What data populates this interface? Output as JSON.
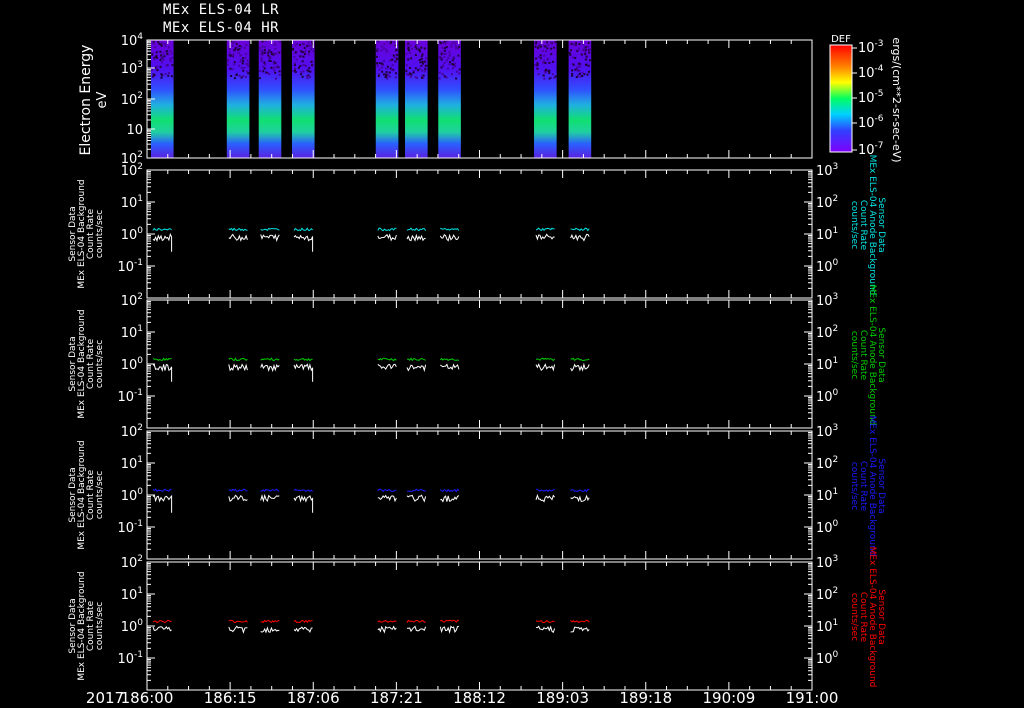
{
  "titles": [
    "MEx ELS-04 LR",
    "MEx ELS-04 HR"
  ],
  "year_label": "2017",
  "x_axis": {
    "ticks": [
      "186:00",
      "186:15",
      "187:06",
      "187:21",
      "188:12",
      "189:03",
      "189:18",
      "190:09",
      "191:00"
    ]
  },
  "colors": {
    "background": "#000000",
    "axes": "#ffffff",
    "panel1": "#00e5e5",
    "panel2": "#00cc00",
    "panel3": "#1a1aff",
    "panel4": "#ff0000",
    "trace": "#ffffff"
  },
  "spectrogram": {
    "ylabel": "Electron Energy",
    "yunit": "eV",
    "yticks": [
      "10",
      "10",
      "10",
      "10",
      "10"
    ],
    "yexps": [
      "4",
      "3",
      "2",
      "",
      "2"
    ],
    "colorbar_label": "DEF",
    "colorbar_ticks": [
      "10",
      "10",
      "10",
      "10",
      "10"
    ],
    "colorbar_exps": [
      "-3",
      "-4",
      "-5",
      "-6",
      "-7"
    ],
    "colorbar_unit": "ergs/(cm**2-sr-sec-eV)"
  },
  "panels": [
    {
      "left_label": [
        "Sensor Data",
        "MEx ELS-04 Background",
        "Count Rate",
        "counts/sec"
      ],
      "right_label": [
        "Sensor Data",
        "MEx ELS-04 Anode Background",
        "Count Rate",
        "counts/sec"
      ],
      "left_ticks": [
        "10",
        "10",
        "10",
        "10"
      ],
      "left_exps": [
        "2",
        "1",
        "0",
        "-1"
      ],
      "right_ticks": [
        "10",
        "10",
        "10",
        "10"
      ],
      "right_exps": [
        "3",
        "2",
        "1",
        "0"
      ]
    },
    {
      "left_label": [
        "Sensor Data",
        "MEx ELS-04 Background",
        "Count Rate",
        "counts/sec"
      ],
      "right_label": [
        "Sensor Data",
        "MEx ELS-04 Anode Background",
        "Count Rate",
        "counts/sec"
      ],
      "left_ticks": [
        "10",
        "10",
        "10",
        "10"
      ],
      "left_exps": [
        "2",
        "1",
        "0",
        "-1"
      ],
      "right_ticks": [
        "10",
        "10",
        "10",
        "10"
      ],
      "right_exps": [
        "3",
        "2",
        "1",
        "0"
      ]
    },
    {
      "left_label": [
        "Sensor Data",
        "MEx ELS-04 Background",
        "Count Rate",
        "counts/sec"
      ],
      "right_label": [
        "Sensor Data",
        "MEx ELS-04 Anode Background",
        "Count Rate",
        "counts/sec"
      ],
      "left_ticks": [
        "10",
        "10",
        "10",
        "10"
      ],
      "left_exps": [
        "2",
        "1",
        "0",
        "-1"
      ],
      "right_ticks": [
        "10",
        "10",
        "10",
        "10"
      ],
      "right_exps": [
        "3",
        "2",
        "1",
        "0"
      ]
    },
    {
      "left_label": [
        "Sensor Data",
        "MEx ELS-04 Background",
        "Count Rate",
        "counts/sec"
      ],
      "right_label": [
        "Sensor Data",
        "MEx ELS-04 Anode Background",
        "Count Rate",
        "counts/sec"
      ],
      "left_ticks": [
        "10",
        "10",
        "10",
        "10"
      ],
      "left_exps": [
        "2",
        "1",
        "0",
        "-1"
      ],
      "right_ticks": [
        "10",
        "10",
        "10",
        "10"
      ],
      "right_exps": [
        "3",
        "2",
        "1",
        "0"
      ]
    }
  ],
  "chart_data": {
    "type": "heatmap",
    "x_range_doy": [
      186.0,
      191.0
    ],
    "spectrogram_ylim_eV": [
      1,
      10000
    ],
    "spectrogram_ylog": true,
    "colorbar_range": [
      1e-07,
      0.001
    ],
    "passes_doy": [
      [
        186.03,
        186.2
      ],
      [
        186.6,
        186.77
      ],
      [
        186.84,
        187.01
      ],
      [
        187.09,
        187.26
      ],
      [
        187.72,
        187.89
      ],
      [
        187.94,
        188.11
      ],
      [
        188.19,
        188.36
      ],
      [
        188.91,
        189.08
      ],
      [
        189.17,
        189.34
      ]
    ],
    "count_rate_ylim": [
      0.01,
      100
    ],
    "count_rate_right_ylim": [
      0.1,
      1000
    ],
    "series": [
      {
        "panel": 1,
        "colored_level": 1.4,
        "white_level": 0.8
      },
      {
        "panel": 2,
        "colored_level": 1.4,
        "white_level": 0.8
      },
      {
        "panel": 3,
        "colored_level": 1.4,
        "white_level": 0.8
      },
      {
        "panel": 4,
        "colored_level": 1.4,
        "white_level": 0.8
      }
    ]
  }
}
